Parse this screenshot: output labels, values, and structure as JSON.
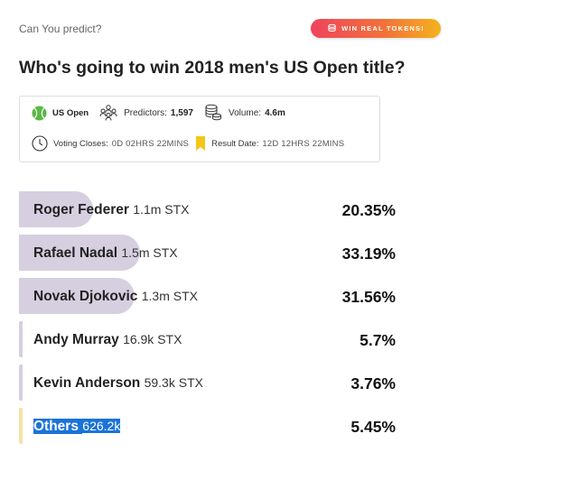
{
  "header": {
    "eyebrow": "Can You predict?",
    "promo_label": "WIN REAL TOKENS!",
    "title": "Who's going to win 2018 men's US Open title?"
  },
  "info": {
    "event": "US Open",
    "predictors_label": "Predictors:",
    "predictors_value": "1,597",
    "volume_label": "Volume:",
    "volume_value": "4.6m",
    "voting_label": "Voting Closes:",
    "voting_value": "0D 02HRS 22MINS",
    "result_label": "Result Date:",
    "result_value": "12D 12HRS 22MINS"
  },
  "options": [
    {
      "name": "Roger Federer",
      "amount": "1.1m STX",
      "percent": "20.35%",
      "share": 0.2035
    },
    {
      "name": "Rafael Nadal",
      "amount": "1.5m STX",
      "percent": "33.19%",
      "share": 0.3319
    },
    {
      "name": "Novak Djokovic",
      "amount": "1.3m STX",
      "percent": "31.56%",
      "share": 0.3156
    },
    {
      "name": "Andy Murray",
      "amount": "16.9k STX",
      "percent": "5.7%",
      "share": 0.057
    },
    {
      "name": "Kevin Anderson",
      "amount": "59.3k STX",
      "percent": "3.76%",
      "share": 0.0376
    },
    {
      "name": "Others",
      "amount": "626.2k",
      "percent": "5.45%",
      "share": 0.0545
    }
  ],
  "colors": {
    "bar": "#d6cfe0",
    "others_bar": "#f6e3a6",
    "promo_start": "#f0445d",
    "promo_end": "#f5b21e",
    "tennis_ball": "#5bb846",
    "bookmark": "#f5c518",
    "selection": "#1a73d9"
  },
  "icons": {
    "promo": "coin-stack-icon",
    "event": "tennis-ball-icon",
    "predictors": "people-group-icon",
    "volume": "coin-stack-icon",
    "voting": "clock-icon",
    "result": "bookmark-icon"
  }
}
